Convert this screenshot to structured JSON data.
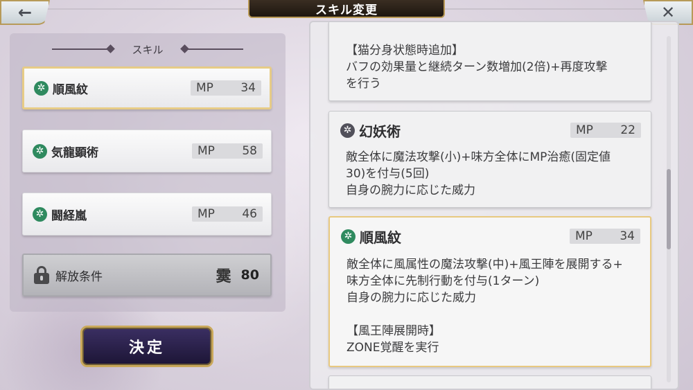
{
  "header": {
    "title": "スキル変更",
    "back_icon": "←",
    "close_icon": "✕"
  },
  "left": {
    "header": "スキル",
    "skills": [
      {
        "name": "順風紋",
        "mp_label": "MP",
        "mp": "34",
        "selected": true
      },
      {
        "name": "気龍顕術",
        "mp_label": "MP",
        "mp": "58",
        "selected": false
      },
      {
        "name": "闘経嵐",
        "mp_label": "MP",
        "mp": "46",
        "selected": false
      }
    ],
    "locked": {
      "label": "解放条件",
      "crystal": "霙",
      "value": "80"
    },
    "confirm": "決定"
  },
  "details": [
    {
      "name": "",
      "lines": [
        "【猫分身状態時追加】",
        "バフの効果量と継続ターン数増加(2倍)+再度攻撃",
        "を行う"
      ]
    },
    {
      "name": "幻妖術",
      "mp_label": "MP",
      "mp": "22",
      "lines": [
        "敵全体に魔法攻撃(小)+味方全体にMP治癒(固定値",
        "30)を付与(5回)",
        "自身の腕力に応じた威力"
      ]
    },
    {
      "name": "順風紋",
      "mp_label": "MP",
      "mp": "34",
      "lines": [
        "敵全体に風属性の魔法攻撃(中)+風王陣を展開する+",
        "味方全体に先制行動を付与(1ターン)",
        "自身の腕力に応じた威力",
        "",
        "【風王陣展開時】",
        "ZONE覚醒を実行"
      ]
    }
  ],
  "colors": {
    "accent_gold": "#e7cc86",
    "skill_icon_green": "#2f8a5f",
    "banner_dark": "#2a2119",
    "confirm_purple": "#2b2250"
  }
}
